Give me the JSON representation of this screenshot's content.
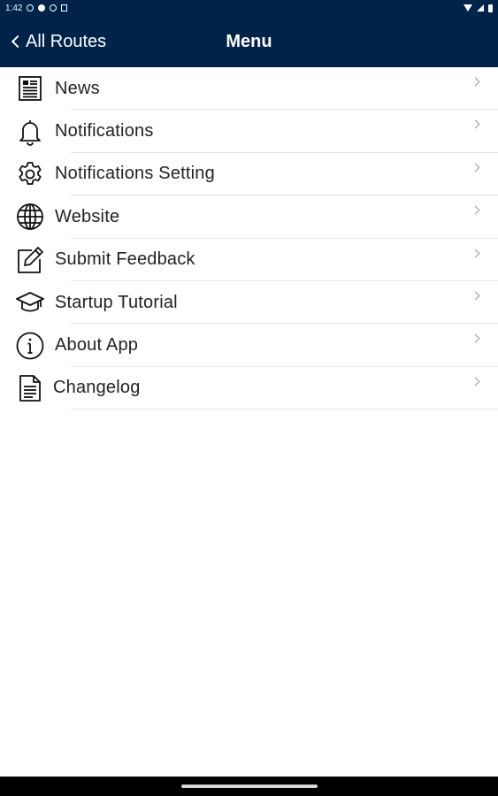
{
  "status_bar": {
    "time": "1:42"
  },
  "header": {
    "back_label": "All Routes",
    "title": "Menu",
    "background_color": "#00234a"
  },
  "menu": {
    "items": [
      {
        "label": "News",
        "icon": "newspaper-icon"
      },
      {
        "label": "Notifications",
        "icon": "bell-icon"
      },
      {
        "label": "Notifications Setting",
        "icon": "gear-icon"
      },
      {
        "label": "Website",
        "icon": "globe-icon"
      },
      {
        "label": "Submit Feedback",
        "icon": "edit-icon"
      },
      {
        "label": "Startup Tutorial",
        "icon": "graduation-cap-icon"
      },
      {
        "label": "About App",
        "icon": "info-icon"
      },
      {
        "label": "Changelog",
        "icon": "document-icon"
      }
    ]
  }
}
